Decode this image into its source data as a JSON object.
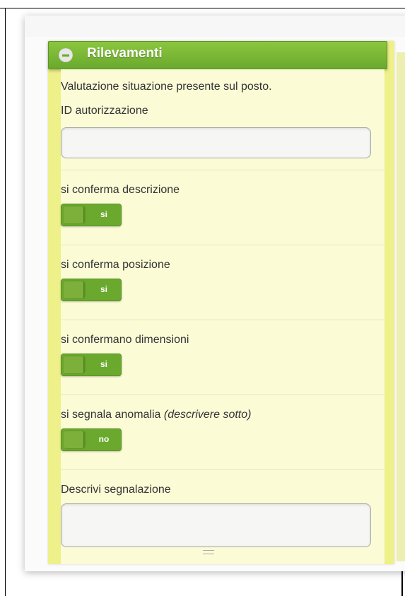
{
  "panel": {
    "title": "Rilevamenti",
    "intro": "Valutazione situazione presente sul posto.",
    "id_label": "ID autorizzazione",
    "id_value": ""
  },
  "fields": [
    {
      "label": "si conferma descrizione",
      "toggle": "si"
    },
    {
      "label": "si conferma posizione",
      "toggle": "si"
    },
    {
      "label": "si confermano dimensioni",
      "toggle": "si"
    },
    {
      "label": "si segnala anomalia",
      "hint": "(descrivere sotto)",
      "toggle": "no"
    }
  ],
  "description": {
    "label": "Descrivi segnalazione",
    "value": ""
  },
  "colors": {
    "header_green": "#6aa92d",
    "panel_yellow": "#fbfbd6"
  }
}
